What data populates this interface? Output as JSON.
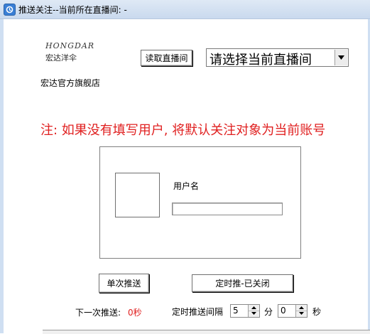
{
  "window": {
    "title": "推送关注--当前所在直播间: -"
  },
  "logo": {
    "top_text": "HONGDAR",
    "bottom_text": "宏达洋伞"
  },
  "header": {
    "read_room_button": "读取直播间",
    "room_select": {
      "selected": "请选择当前直播间"
    },
    "store_name": "宏达官方旗舰店"
  },
  "note": "注: 如果没有填写用户, 将默认关注对象为当前账号",
  "user": {
    "label": "用户名",
    "input_value": ""
  },
  "actions": {
    "single_push": "单次推送",
    "timed_push": "定时推-已关闭"
  },
  "footer": {
    "next_push_label": "下一次推送:",
    "next_push_value": "0秒",
    "interval_label": "定时推送间隔",
    "minutes_value": "5",
    "minutes_unit": "分",
    "seconds_value": "0",
    "seconds_unit": "秒"
  },
  "colors": {
    "note_red": "#e02020",
    "titlebar": "#c9d9ee"
  }
}
